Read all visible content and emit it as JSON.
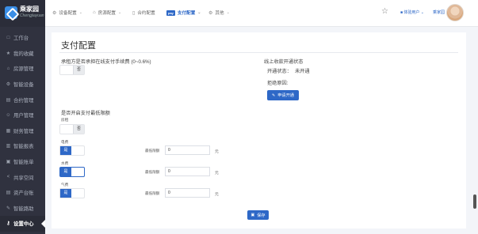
{
  "sidebar": {
    "logo_text": "乘家园",
    "logo_sub": "Chengjiayuan",
    "items": [
      {
        "label": "工作台",
        "icon": "□"
      },
      {
        "label": "我的收藏",
        "icon": "★"
      },
      {
        "label": "房源管理",
        "icon": "⌂"
      },
      {
        "label": "智能设备",
        "icon": "⚙"
      },
      {
        "label": "合约管理",
        "icon": "▤"
      },
      {
        "label": "用户管理",
        "icon": "☺"
      },
      {
        "label": "财务管理",
        "icon": "▦"
      },
      {
        "label": "智能报表",
        "icon": "▥"
      },
      {
        "label": "智能账单",
        "icon": "▣"
      },
      {
        "label": "共享空间",
        "icon": "<"
      },
      {
        "label": "资产台账",
        "icon": "▤"
      },
      {
        "label": "智能路助",
        "icon": "✎"
      },
      {
        "label": "设置中心",
        "icon": "⚷"
      }
    ]
  },
  "topbar": {
    "nav": [
      {
        "label": "设备配置",
        "icon": "⚙"
      },
      {
        "label": "房源配置",
        "icon": "⌂"
      },
      {
        "label": "合约配置",
        "icon": "▯"
      },
      {
        "label": "支付配置",
        "icon": "pay"
      },
      {
        "label": "其他",
        "icon": "⚙"
      }
    ],
    "user_badge": "■ 体验用户 ⌄",
    "user_name": "乘家园"
  },
  "page": {
    "title": "支付配置",
    "fee_question": "承租方是否承担在线支付手续费 (0~0.6%)",
    "fee_toggle": "否",
    "online_title": "线上收款开通状态",
    "status_label": "开通状态：",
    "status_value": "未开通",
    "reject_label": "拒绝原因:",
    "apply_button": "申请开通",
    "min_title": "是否开启支付最低限额",
    "rent_label": "房租",
    "rent_toggle": "否",
    "electric_label": "电费",
    "electric_toggle": "是",
    "water_label": "水费",
    "water_toggle": "是",
    "gas_label": "气费",
    "gas_toggle": "是",
    "min_label": "最低限额",
    "electric_value": "0",
    "water_value": "0",
    "gas_value": "0",
    "unit": "元",
    "save_button": "保存"
  },
  "colors": {
    "primary": "#2e68c7",
    "sidebar": "#30323f"
  }
}
